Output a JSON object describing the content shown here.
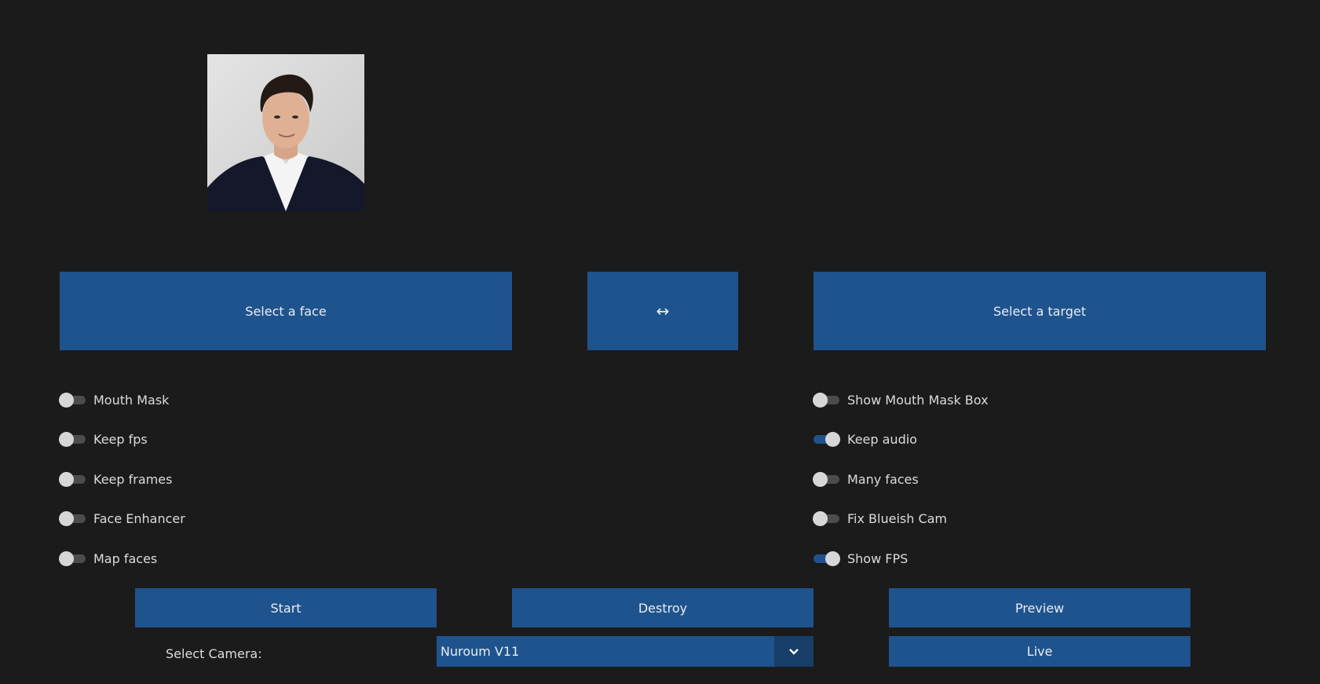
{
  "source_face": {
    "description": "portrait-photo"
  },
  "buttons": {
    "select_face": "Select a face",
    "swap": "↔",
    "select_target": "Select a target",
    "start": "Start",
    "destroy": "Destroy",
    "preview": "Preview",
    "live": "Live"
  },
  "left_switches": [
    {
      "label": "Mouth Mask",
      "on": false
    },
    {
      "label": "Keep fps",
      "on": false
    },
    {
      "label": "Keep frames",
      "on": false
    },
    {
      "label": "Face Enhancer",
      "on": false
    },
    {
      "label": "Map faces",
      "on": false
    }
  ],
  "right_switches": [
    {
      "label": "Show Mouth Mask Box",
      "on": false
    },
    {
      "label": "Keep audio",
      "on": true
    },
    {
      "label": "Many faces",
      "on": false
    },
    {
      "label": "Fix Blueish Cam",
      "on": false
    },
    {
      "label": "Show FPS",
      "on": true
    }
  ],
  "camera": {
    "label": "Select Camera:",
    "selected": "Nuroum V11",
    "arrow_icon": "chevron-down-icon"
  },
  "colors": {
    "background": "#1b1b1b",
    "accent": "#1f538d",
    "switch_off": "#4a4d50",
    "knob": "#d7d7d7"
  }
}
